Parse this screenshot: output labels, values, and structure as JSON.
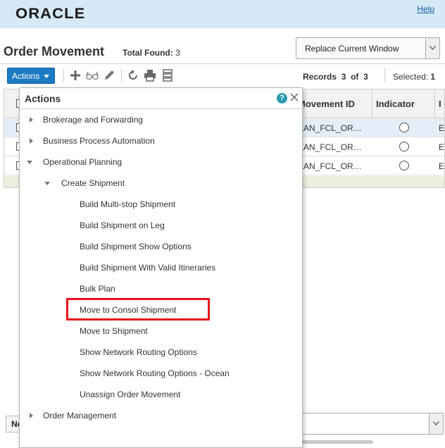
{
  "header": {
    "logo_text": "ORACLE",
    "help_label": "Help"
  },
  "page": {
    "title": "Order Movement",
    "total_found_label": "Total Found:",
    "total_found_value": "3",
    "window_mode": "Replace Current Window"
  },
  "toolbar": {
    "actions_label": "Actions",
    "icons": [
      "plus-icon",
      "glasses-icon",
      "pencil-icon",
      "refresh-icon",
      "print-icon",
      "list-icon"
    ],
    "records_label": "Records",
    "records_from": "3",
    "records_of": "of",
    "records_total": "3",
    "selected_label": "Selected:",
    "selected_value": "1"
  },
  "table": {
    "headers": {
      "movement_id": "Movement ID",
      "indicator": "Indicator",
      "extra": "I"
    },
    "rows": [
      {
        "movement_id": "EAN_FCL_OR…",
        "extra": "E",
        "selected": true
      },
      {
        "movement_id": "EAN_FCL_OR…",
        "extra": "E",
        "selected": false
      },
      {
        "movement_id": "EAN_FCL_OR…",
        "extra": "E",
        "selected": false
      }
    ]
  },
  "bottom": {
    "button_label": "Ne"
  },
  "actions_popup": {
    "title": "Actions",
    "items": [
      {
        "label": "Brokerage and Forwarding",
        "level": 0,
        "state": "collapsed"
      },
      {
        "label": "Business Process Automation",
        "level": 0,
        "state": "collapsed"
      },
      {
        "label": "Operational Planning",
        "level": 0,
        "state": "expanded"
      },
      {
        "label": "Create Shipment",
        "level": 1,
        "state": "expanded"
      },
      {
        "label": "Build Multi-stop Shipment",
        "level": 2,
        "state": "leaf"
      },
      {
        "label": "Build Shipment on Leg",
        "level": 2,
        "state": "leaf"
      },
      {
        "label": "Build Shipment Show Options",
        "level": 2,
        "state": "leaf"
      },
      {
        "label": "Build Shipment With Valid Itineraries",
        "level": 2,
        "state": "leaf"
      },
      {
        "label": "Bulk Plan",
        "level": 2,
        "state": "leaf"
      },
      {
        "label": "Move to Consol Shipment",
        "level": 2,
        "state": "leaf",
        "highlighted": true
      },
      {
        "label": "Move to Shipment",
        "level": 2,
        "state": "leaf"
      },
      {
        "label": "Show Network Routing Options",
        "level": 2,
        "state": "leaf"
      },
      {
        "label": "Show Network Routing Options - Ocean",
        "level": 2,
        "state": "leaf"
      },
      {
        "label": "Unassign Order Movement",
        "level": 2,
        "state": "leaf"
      },
      {
        "label": "Order Management",
        "level": 0,
        "state": "collapsed"
      }
    ]
  },
  "colors": {
    "header_bg": "#d5e9f7",
    "actions_button": "#1c7ac4",
    "highlight": "#e8121b",
    "selected_row": "#e3eef8"
  }
}
